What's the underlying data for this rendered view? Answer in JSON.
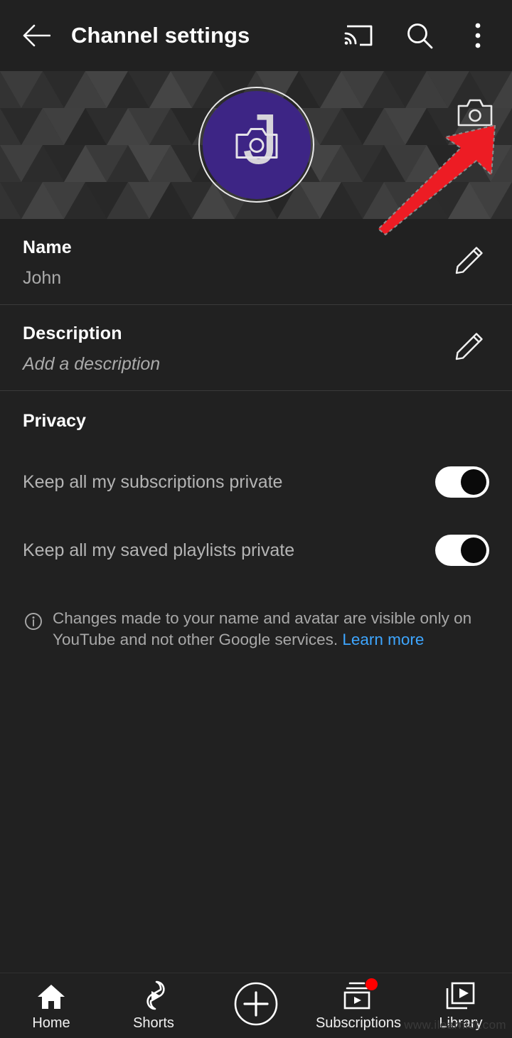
{
  "header": {
    "title": "Channel settings",
    "back_icon": "back-arrow-icon",
    "cast_icon": "cast-icon",
    "search_icon": "search-icon",
    "more_icon": "more-vertical-icon"
  },
  "banner": {
    "avatar_letter": "J",
    "avatar_color": "#3d2585",
    "avatar_camera_icon": "camera-icon",
    "banner_camera_icon": "camera-icon",
    "annotation": {
      "shape": "arrow",
      "color": "#ed1c24",
      "points_to": "banner-camera-button"
    }
  },
  "rows": [
    {
      "label": "Name",
      "value": "John",
      "is_placeholder": false,
      "edit_icon": "pencil-icon"
    },
    {
      "label": "Description",
      "value": "Add a description",
      "is_placeholder": true,
      "edit_icon": "pencil-icon"
    }
  ],
  "privacy": {
    "title": "Privacy",
    "toggles": [
      {
        "label": "Keep all my subscriptions private",
        "state": "on"
      },
      {
        "label": "Keep all my saved playlists private",
        "state": "on"
      }
    ]
  },
  "note": {
    "icon": "info-circle-icon",
    "text": "Changes made to your name and avatar are visible only on YouTube and not other Google services.",
    "link_label": "Learn more",
    "link_color": "#3ea6ff"
  },
  "bottom_nav": {
    "items": [
      {
        "label": "Home",
        "icon": "home-icon",
        "active": true,
        "badge": false
      },
      {
        "label": "Shorts",
        "icon": "shorts-icon",
        "active": false,
        "badge": false
      },
      {
        "label": "",
        "icon": "create-plus-icon",
        "active": false,
        "badge": false
      },
      {
        "label": "Subscriptions",
        "icon": "subscriptions-icon",
        "active": false,
        "badge": true
      },
      {
        "label": "Library",
        "icon": "library-icon",
        "active": false,
        "badge": false
      }
    ],
    "badge_color": "#ff0000"
  },
  "watermark": {
    "text": "www.ilearnlot.com"
  }
}
